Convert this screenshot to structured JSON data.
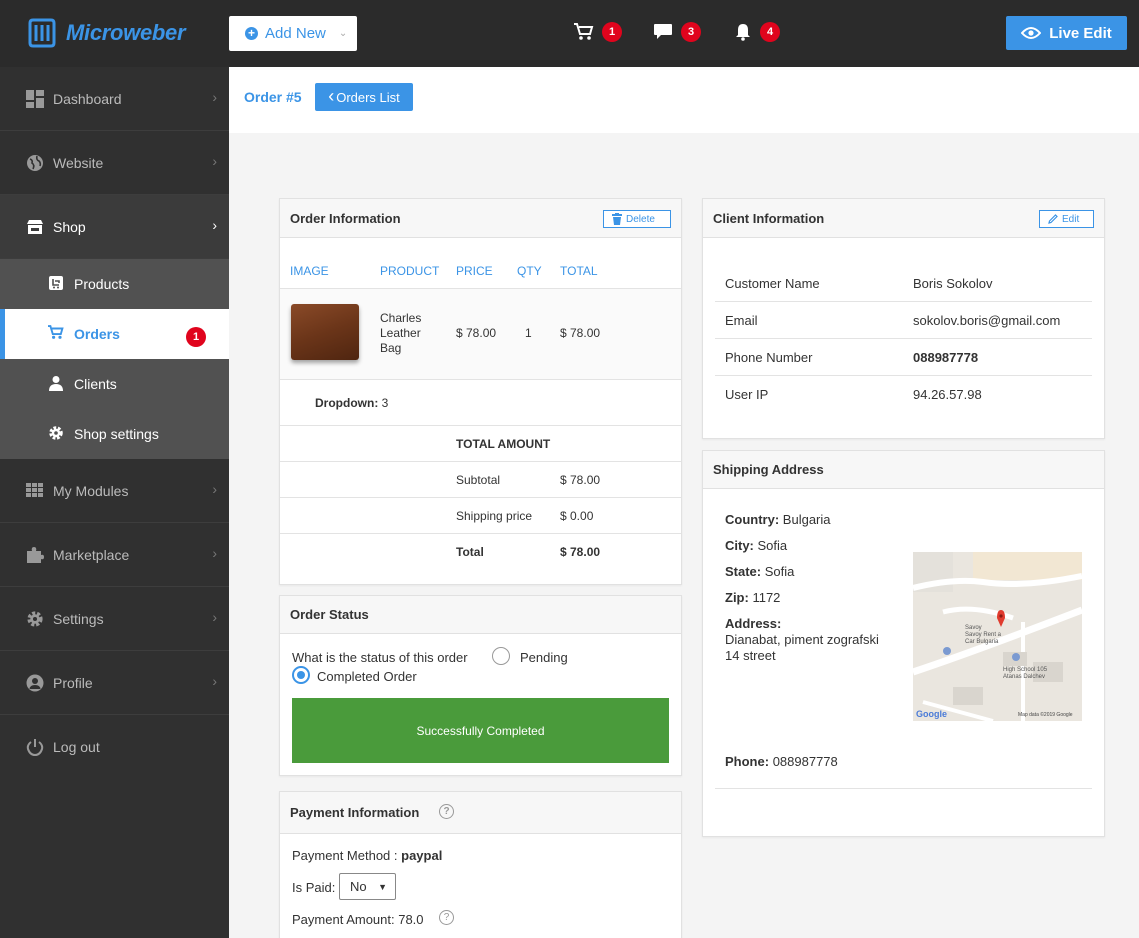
{
  "brand": {
    "name": "Microweber"
  },
  "topbar": {
    "add_new": "Add New",
    "cart_count": "1",
    "comments_count": "3",
    "notifications_count": "4",
    "live_edit": "Live Edit"
  },
  "sidebar": {
    "dashboard": "Dashboard",
    "website": "Website",
    "shop": "Shop",
    "products": "Products",
    "orders": "Orders",
    "orders_badge": "1",
    "clients": "Clients",
    "shop_settings": "Shop settings",
    "my_modules": "My Modules",
    "marketplace": "Marketplace",
    "settings": "Settings",
    "profile": "Profile",
    "logout": "Log out"
  },
  "page": {
    "title": "Order #5",
    "orders_list": "Orders List"
  },
  "order_info": {
    "title": "Order Information",
    "delete": "Delete",
    "columns": [
      "IMAGE",
      "PRODUCT",
      "PRICE",
      "QTY",
      "TOTAL"
    ],
    "item": {
      "product_line1": "Charles",
      "product_line2": "Leather",
      "product_line3": "Bag",
      "price": "$ 78.00",
      "qty": "1",
      "total": "$ 78.00"
    },
    "dropdown_label": "Dropdown:",
    "dropdown_value": "3",
    "total_amount": "TOTAL AMOUNT",
    "subtotal_label": "Subtotal",
    "subtotal": "$ 78.00",
    "shipping_label": "Shipping price",
    "shipping": "$ 0.00",
    "total_label": "Total",
    "total": "$ 78.00"
  },
  "order_status": {
    "title": "Order Status",
    "question": "What is the status of this order",
    "pending": "Pending",
    "completed": "Completed Order",
    "banner": "Successfully Completed"
  },
  "payment": {
    "title": "Payment Information",
    "method_label": "Payment Method :",
    "method": "paypal",
    "is_paid_label": "Is Paid:",
    "is_paid": "No",
    "amount_label": "Payment Amount: 78.0"
  },
  "client": {
    "title": "Client Information",
    "edit": "Edit",
    "rows": [
      {
        "label": "Customer Name",
        "value": "Boris Sokolov"
      },
      {
        "label": "Email",
        "value": "sokolov.boris@gmail.com"
      },
      {
        "label": "Phone Number",
        "value": "088987778"
      },
      {
        "label": "User IP",
        "value": "94.26.57.98"
      }
    ]
  },
  "shipping": {
    "title": "Shipping Address",
    "country_label": "Country:",
    "country": "Bulgaria",
    "city_label": "City:",
    "city": "Sofia",
    "state_label": "State:",
    "state": "Sofia",
    "zip_label": "Zip:",
    "zip": "1172",
    "address_label": "Address:",
    "address_line1": "Dianabat, piment zografski",
    "address_line2": "14 street",
    "phone_label": "Phone:",
    "phone": "088987778",
    "map": {
      "place1_line1": "Savoy",
      "place1_line2": "Savoy Rent a",
      "place1_line3": "Car Bulgaria",
      "place2_line1": "High School 105",
      "place2_line2": "Atanas Dalchev",
      "google": "Google",
      "map_data": "Map data ©2019 Google"
    }
  },
  "colors": {
    "accent": "#3b94e6",
    "badge": "#e0041d",
    "success": "#4a9b3b",
    "sidebar": "#303030"
  }
}
